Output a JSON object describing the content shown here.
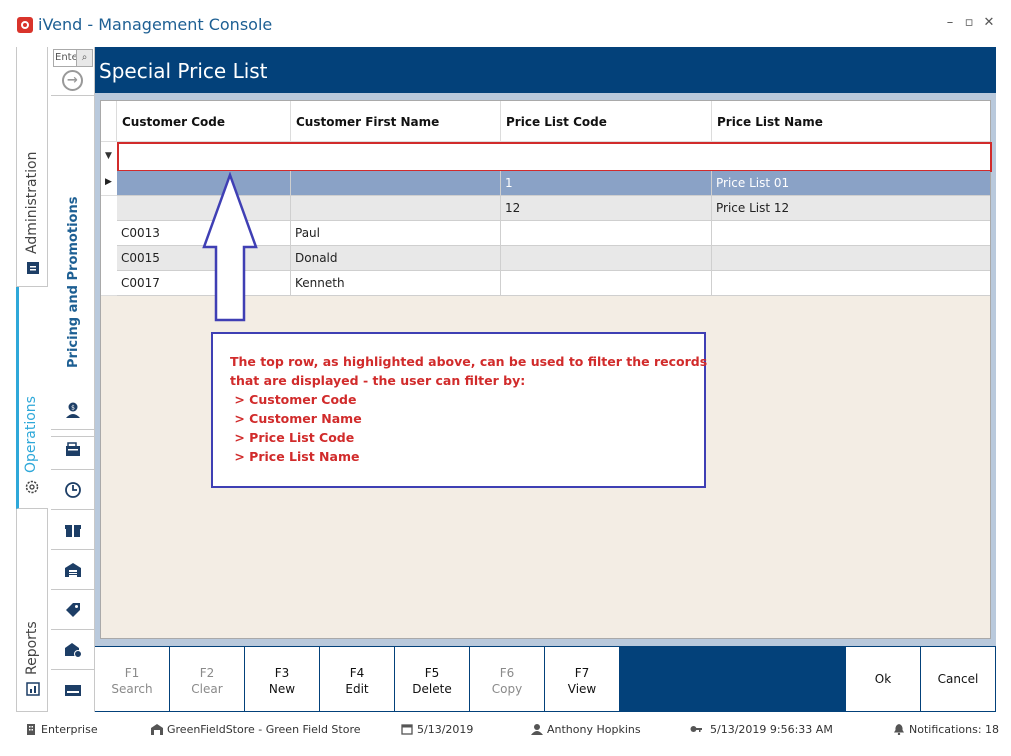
{
  "window": {
    "title": "iVend - Management Console"
  },
  "leftnav": {
    "administration": "Administration",
    "operations": "Operations",
    "reports": "Reports"
  },
  "subnav": {
    "search_placeholder": "Ente",
    "active_section": "Pricing and Promotions"
  },
  "header": {
    "title": "Special Price List"
  },
  "grid": {
    "columns": [
      "Customer Code",
      "Customer First Name",
      "Price List Code",
      "Price List Name"
    ],
    "rows": [
      {
        "code": "",
        "name": "",
        "plcode": "1",
        "plname": "Price List 01",
        "selected": true
      },
      {
        "code": "",
        "name": "",
        "plcode": "12",
        "plname": "Price List 12"
      },
      {
        "code": "C0013",
        "name": "Paul",
        "plcode": "",
        "plname": ""
      },
      {
        "code": "C0015",
        "name": "Donald",
        "plcode": "",
        "plname": ""
      },
      {
        "code": "C0017",
        "name": "Kenneth",
        "plcode": "",
        "plname": ""
      }
    ]
  },
  "callout": {
    "lines": [
      "The top row, as highlighted above, can be used to filter the records",
      "that are displayed - the user can filter by:",
      " > Customer Code",
      " > Customer Name",
      " > Price List Code",
      " > Price List Name"
    ]
  },
  "fkeys": [
    {
      "key": "F1",
      "label": "Search",
      "enabled": false
    },
    {
      "key": "F2",
      "label": "Clear",
      "enabled": false
    },
    {
      "key": "F3",
      "label": "New",
      "enabled": true
    },
    {
      "key": "F4",
      "label": "Edit",
      "enabled": true
    },
    {
      "key": "F5",
      "label": "Delete",
      "enabled": true
    },
    {
      "key": "F6",
      "label": "Copy",
      "enabled": false
    },
    {
      "key": "F7",
      "label": "View",
      "enabled": true
    }
  ],
  "actions": {
    "ok": "Ok",
    "cancel": "Cancel"
  },
  "status": {
    "enterprise": "Enterprise",
    "store": "GreenFieldStore - Green Field Store",
    "date": "5/13/2019",
    "user": "Anthony Hopkins",
    "datetime": "5/13/2019 9:56:33 AM",
    "notifications": "Notifications: 18"
  },
  "colors": {
    "accent": "#03417a",
    "highlight": "#d12b2b",
    "callout_border": "#3f3fb4",
    "ops": "#2ea8d9"
  }
}
